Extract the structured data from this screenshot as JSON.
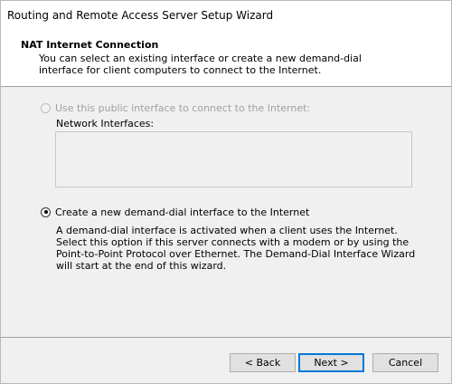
{
  "window": {
    "title": "Routing and Remote Access Server Setup Wizard"
  },
  "header": {
    "heading": "NAT Internet Connection",
    "description": "You can select an existing interface or create a new demand-dial interface for client computers to connect to the Internet."
  },
  "options": {
    "use_public": {
      "label": "Use this public interface to connect to the Internet:",
      "selected": false,
      "enabled": false
    },
    "network_interfaces_label": "Network Interfaces:",
    "create_demand_dial": {
      "label": "Create a new demand-dial interface to the Internet",
      "selected": true,
      "enabled": true,
      "description": "A demand-dial interface is activated when a client uses the Internet. Select this option if this server connects with a modem or by using the Point-to-Point Protocol over Ethernet. The Demand-Dial Interface Wizard will start at the end of this wizard."
    }
  },
  "buttons": {
    "back": "< Back",
    "next": "Next >",
    "cancel": "Cancel"
  }
}
